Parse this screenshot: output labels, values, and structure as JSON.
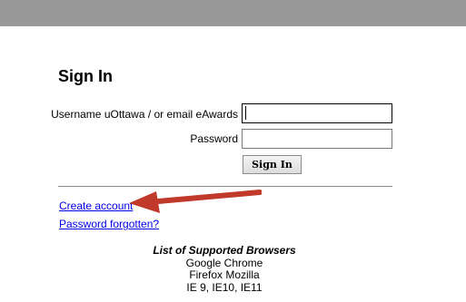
{
  "page": {
    "heading": "Sign In"
  },
  "form": {
    "username_label": "Username uOttawa / or email eAwards",
    "username_value": "",
    "password_label": "Password",
    "password_value": "",
    "submit_label": "Sign In"
  },
  "links": {
    "create_account": "Create account",
    "password_forgotten": "Password forgotten?"
  },
  "browsers": {
    "title": "List of Supported Browsers",
    "items": [
      "Google Chrome",
      "Firefox Mozilla",
      "IE 9, IE10, IE11"
    ]
  },
  "annotation": {
    "arrow_color": "#c0392b",
    "arrow_icon": "arrow-left-icon"
  },
  "colors": {
    "top_bar": "#999999",
    "link": "#0000ee"
  }
}
